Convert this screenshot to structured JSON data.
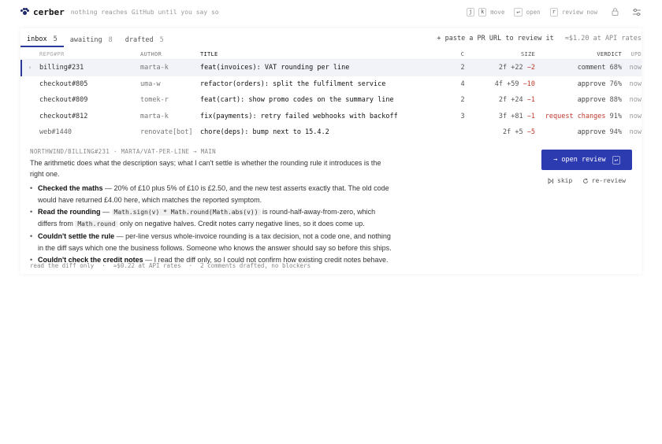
{
  "app": {
    "name": "cerber",
    "tagline": "nothing reaches GitHub until you say so"
  },
  "hotkeys": [
    {
      "keys": "j",
      "label": ""
    },
    {
      "keys": "k",
      "label": "move"
    },
    {
      "keys": "↵",
      "label": "open"
    },
    {
      "keys": "r",
      "label": "review now"
    }
  ],
  "tabs": [
    {
      "label": "inbox",
      "count": "5"
    },
    {
      "label": "awaiting",
      "count": "8"
    },
    {
      "label": "drafted",
      "count": "5"
    }
  ],
  "paste": {
    "label": "+ paste a PR URL to review it",
    "rate": "≈$1.20 at API rates"
  },
  "columns": {
    "repo": "REPO#PR",
    "author": "AUTHOR",
    "title": "TITLE",
    "c": "C",
    "size": "SIZE",
    "verdict": "VERDICT",
    "upd": "UPD"
  },
  "rows": [
    {
      "repo": "billing#231",
      "author": "marta-k",
      "title": "feat(invoices): VAT rounding per line",
      "c": "2",
      "files": "2f",
      "plus": "+22",
      "minus": "−2",
      "verdict": "comment",
      "pct": "68%",
      "upd": "now"
    },
    {
      "repo": "checkout#805",
      "author": "uma-w",
      "title": "refactor(orders): split the fulfilment service",
      "c": "4",
      "files": "4f",
      "plus": "+59",
      "minus": "−10",
      "verdict": "approve",
      "pct": "76%",
      "upd": "now"
    },
    {
      "repo": "checkout#809",
      "author": "tomek-r",
      "title": "feat(cart): show promo codes on the summary line",
      "c": "2",
      "files": "2f",
      "plus": "+24",
      "minus": "−1",
      "verdict": "approve",
      "pct": "88%",
      "upd": "now"
    },
    {
      "repo": "checkout#812",
      "author": "marta-k",
      "title": "fix(payments): retry failed webhooks with backoff",
      "c": "3",
      "files": "3f",
      "plus": "+81",
      "minus": "−1",
      "verdict": "request changes",
      "pct": "91%",
      "upd": "now"
    },
    {
      "repo": "web#1440",
      "author": "renovate[bot]",
      "title": "chore(deps): bump next to 15.4.2",
      "c": "",
      "files": "2f",
      "plus": "+5",
      "minus": "−5",
      "verdict": "approve",
      "pct": "94%",
      "upd": "now"
    }
  ],
  "detail": {
    "crumb": "NORTHWIND/BILLING#231 · MARTA/VAT-PER-LINE → MAIN",
    "summary": "The arithmetic does what the description says; what I can't settle is whether the rounding rule it introduces is the right one.",
    "b1_head": "Checked the maths",
    "b1_text": " — 20% of £10 plus 5% of £10 is £2.50, and the new test asserts exactly that. The old code would have returned £4.00 here, which matches the reported symptom.",
    "b2_head": "Read the rounding",
    "b2_pre": " — ",
    "b2_code1": "Math.sign(v) * Math.round(Math.abs(v))",
    "b2_mid": " is round-half-away-from-zero, which differs from ",
    "b2_code2": "Math.round",
    "b2_post": " only on negative halves. Credit notes carry negative lines, so it does come up.",
    "b3_head": "Couldn't settle the rule",
    "b3_text": " — per-line versus whole-invoice rounding is a tax decision, not a code one, and nothing in the diff says which one the business follows. Someone who knows the answer should say so before this ships.",
    "b4_head": "Couldn't check the credit notes",
    "b4_text": " — I read the diff only, so I could not confirm how existing credit notes behave."
  },
  "actions": {
    "open": "→ open review",
    "open_key": "↵",
    "skip": "skip",
    "rereview": "re-review"
  },
  "footer": {
    "mode": "read the diff only",
    "cost": "≈$0.22 at API rates",
    "status": "2 comments drafted, no blockers"
  }
}
